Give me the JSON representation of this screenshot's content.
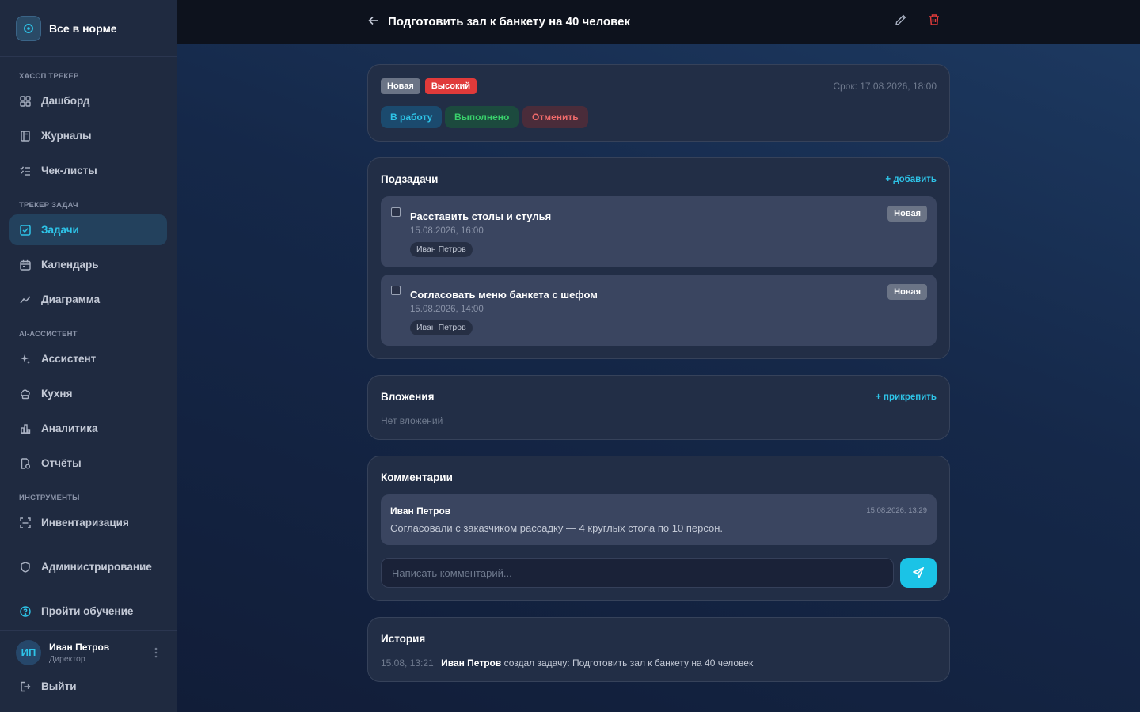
{
  "sidebar": {
    "brand_title": "Все в норме",
    "sections": {
      "haccp": "ХАССП ТРЕКЕР",
      "tasks": "ТРЕКЕР ЗАДАЧ",
      "ai": "AI-АССИСТЕНТ",
      "tools": "ИНСТРУМЕНТЫ"
    },
    "items": {
      "dashboard": "Дашборд",
      "journals": "Журналы",
      "checklists": "Чек-листы",
      "tasks": "Задачи",
      "calendar": "Календарь",
      "diagram": "Диаграмма",
      "assistant": "Ассистент",
      "kitchen": "Кухня",
      "analytics": "Аналитика",
      "reports": "Отчёты",
      "inventory": "Инвентаризация",
      "admin": "Администрирование",
      "tutorial": "Пройти обучение",
      "logout": "Выйти"
    },
    "active_item": "tasks",
    "user": {
      "initials": "ИП",
      "name": "Иван Петров",
      "role": "Директор"
    }
  },
  "header": {
    "title": "Подготовить зал к банкету на 40 человек"
  },
  "task": {
    "status_badge": "Новая",
    "priority_badge": "Высокий",
    "deadline": "Срок: 17.08.2026, 18:00",
    "actions": {
      "start": "В работу",
      "done": "Выполнено",
      "cancel": "Отменить"
    }
  },
  "subtasks": {
    "title": "Подзадачи",
    "add_link": "+ добавить",
    "items": [
      {
        "title": "Расставить столы и стулья",
        "date": "15.08.2026, 16:00",
        "assignee": "Иван Петров",
        "status": "Новая",
        "checked": false
      },
      {
        "title": "Согласовать меню банкета с шефом",
        "date": "15.08.2026, 14:00",
        "assignee": "Иван Петров",
        "status": "Новая",
        "checked": false
      }
    ]
  },
  "attachments": {
    "title": "Вложения",
    "attach_link": "+ прикрепить",
    "empty_text": "Нет вложений"
  },
  "comments": {
    "title": "Комментарии",
    "items": [
      {
        "author": "Иван Петров",
        "time": "15.08.2026, 13:29",
        "text": "Согласовали с заказчиком рассадку — 4 круглых стола по 10 персон."
      }
    ],
    "input_placeholder": "Написать комментарий..."
  },
  "history": {
    "title": "История",
    "items": [
      {
        "time": "15.08, 13:21",
        "user": "Иван Петров",
        "action": "создал задачу: Подготовить зал к банкету на 40 человек"
      }
    ]
  },
  "colors": {
    "accent": "#2ec4e8",
    "danger": "#e03a3a",
    "success": "#39d06b",
    "badge_neutral": "#6b7486"
  }
}
